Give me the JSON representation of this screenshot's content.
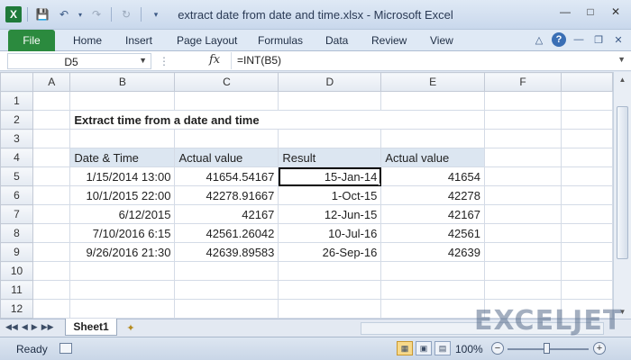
{
  "window": {
    "title": "extract date from date and time.xlsx - Microsoft Excel",
    "app_icon_letter": "X",
    "accent": "#2b8a3e"
  },
  "ribbon": {
    "file_label": "File",
    "tabs": [
      "Home",
      "Insert",
      "Page Layout",
      "Formulas",
      "Data",
      "Review",
      "View"
    ]
  },
  "formula_bar": {
    "name_box": "D5",
    "fx": "fx",
    "formula": "=INT(B5)"
  },
  "grid": {
    "columns": [
      "A",
      "B",
      "C",
      "D",
      "E",
      "F"
    ],
    "rows": [
      "1",
      "2",
      "3",
      "4",
      "5",
      "6",
      "7",
      "8",
      "9",
      "10",
      "11",
      "12"
    ],
    "active_cell": "D5",
    "heading": "Extract time from a date and time",
    "table_headers": [
      "Date & Time",
      "Actual value",
      "Result",
      "Actual value"
    ],
    "table_rows": [
      [
        "1/15/2014 13:00",
        "41654.54167",
        "15-Jan-14",
        "41654"
      ],
      [
        "10/1/2015 22:00",
        "42278.91667",
        "1-Oct-15",
        "42278"
      ],
      [
        "6/12/2015",
        "42167",
        "12-Jun-15",
        "42167"
      ],
      [
        "7/10/2016 6:15",
        "42561.26042",
        "10-Jul-16",
        "42561"
      ],
      [
        "9/26/2016 21:30",
        "42639.89583",
        "26-Sep-16",
        "42639"
      ]
    ]
  },
  "sheets": {
    "active": "Sheet1"
  },
  "branding": {
    "logo_text": "EXCELJET"
  },
  "status": {
    "text": "Ready",
    "zoom": "100%",
    "zoom_minus": "−",
    "zoom_plus": "+"
  }
}
